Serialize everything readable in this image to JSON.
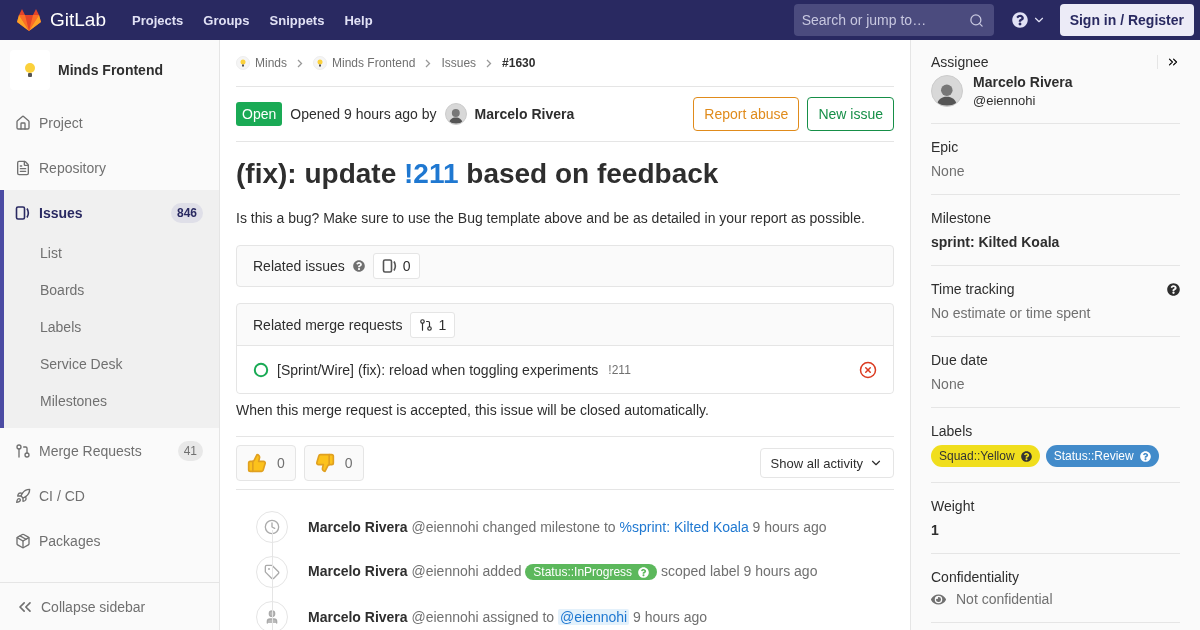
{
  "header": {
    "logo_text": "GitLab",
    "nav": [
      "Projects",
      "Groups",
      "Snippets",
      "Help"
    ],
    "search": {
      "placeholder": "Search or jump to…"
    },
    "sign_in": "Sign in / Register"
  },
  "sidebar": {
    "project_name": "Minds Frontend",
    "items": [
      {
        "label": "Project",
        "selected": false
      },
      {
        "label": "Repository",
        "selected": false
      },
      {
        "label": "Issues",
        "count": "846",
        "selected": true,
        "children": [
          {
            "label": "List",
            "selected": false
          },
          {
            "label": "Boards",
            "selected": false
          },
          {
            "label": "Labels",
            "selected": false
          },
          {
            "label": "Service Desk",
            "selected": false
          },
          {
            "label": "Milestones",
            "selected": false
          }
        ]
      },
      {
        "label": "Merge Requests",
        "count": "41",
        "selected": false
      },
      {
        "label": "CI / CD",
        "selected": false
      },
      {
        "label": "Packages",
        "selected": false
      }
    ],
    "collapse": "Collapse sidebar"
  },
  "breadcrumbs": [
    {
      "label": "Minds",
      "avatar": true,
      "current": false
    },
    {
      "label": "Minds Frontend",
      "avatar": true,
      "current": false
    },
    {
      "label": "Issues",
      "avatar": false,
      "current": false
    },
    {
      "label": "#1630",
      "avatar": false,
      "current": true
    }
  ],
  "issue": {
    "status": "Open",
    "opened": "Opened 9 hours ago by",
    "author": "Marcelo Rivera",
    "report_abuse": "Report abuse",
    "new_issue": "New issue",
    "title_before": "(fix): update ",
    "title_link": "!211",
    "title_after": " based on feedback",
    "description": "Is this a bug? Make sure to use the Bug template above and be as detailed in your report as possible."
  },
  "related_issues": {
    "title": "Related issues",
    "count": "0"
  },
  "related_merge_requests": {
    "title": "Related merge requests",
    "count": "1",
    "items": [
      {
        "title": "[Sprint/Wire] (fix): reload when toggling experiments",
        "ref": "!211"
      }
    ]
  },
  "closing_note": "When this merge request is accepted, this issue will be closed automatically.",
  "awards": [
    {
      "kind": "thumbsup",
      "count": "0"
    },
    {
      "kind": "thumbsdown",
      "count": "0"
    }
  ],
  "activity_filter": "Show all activity",
  "timeline": [
    {
      "parts": [
        {
          "kind": "author",
          "text": "Marcelo Rivera"
        },
        {
          "kind": "text",
          "text": " @eiennohi changed milestone to "
        },
        {
          "kind": "link",
          "text": "%sprint: Kilted Koala"
        },
        {
          "kind": "text",
          "text": " 9 hours ago"
        }
      ]
    },
    {
      "parts": [
        {
          "kind": "author",
          "text": "Marcelo Rivera"
        },
        {
          "kind": "text",
          "text": " @eiennohi added "
        },
        {
          "kind": "label",
          "text": "Status::InProgress",
          "color": "#5cb85c"
        },
        {
          "kind": "text",
          "text": " scoped label 9 hours ago"
        }
      ]
    },
    {
      "parts": [
        {
          "kind": "author",
          "text": "Marcelo Rivera"
        },
        {
          "kind": "text",
          "text": " @eiennohi assigned to "
        },
        {
          "kind": "mention",
          "text": "@eiennohi"
        },
        {
          "kind": "text",
          "text": " 9 hours ago"
        }
      ]
    }
  ],
  "right_sidebar": {
    "assignee": {
      "heading": "Assignee",
      "name": "Marcelo Rivera",
      "username": "@eiennohi"
    },
    "blocks": [
      {
        "heading": "Epic",
        "kind": "muted",
        "value": "None",
        "help": false
      },
      {
        "heading": "Milestone",
        "kind": "bold",
        "value": "sprint: Kilted Koala",
        "help": false
      },
      {
        "heading": "Time tracking",
        "kind": "muted",
        "value": "No estimate or time spent",
        "help": true
      },
      {
        "heading": "Due date",
        "kind": "muted",
        "value": "None",
        "help": false
      },
      {
        "heading": "Labels",
        "kind": "labels",
        "labels": [
          {
            "text": "Squad::Yellow",
            "color": "#f0de1d"
          },
          {
            "text": "Status::Review",
            "color": "#428bca"
          }
        ],
        "help": false
      },
      {
        "heading": "Weight",
        "kind": "bold",
        "value": "1",
        "help": false
      },
      {
        "heading": "Confidentiality",
        "kind": "confidential",
        "value": "Not confidential",
        "help": false
      }
    ]
  }
}
